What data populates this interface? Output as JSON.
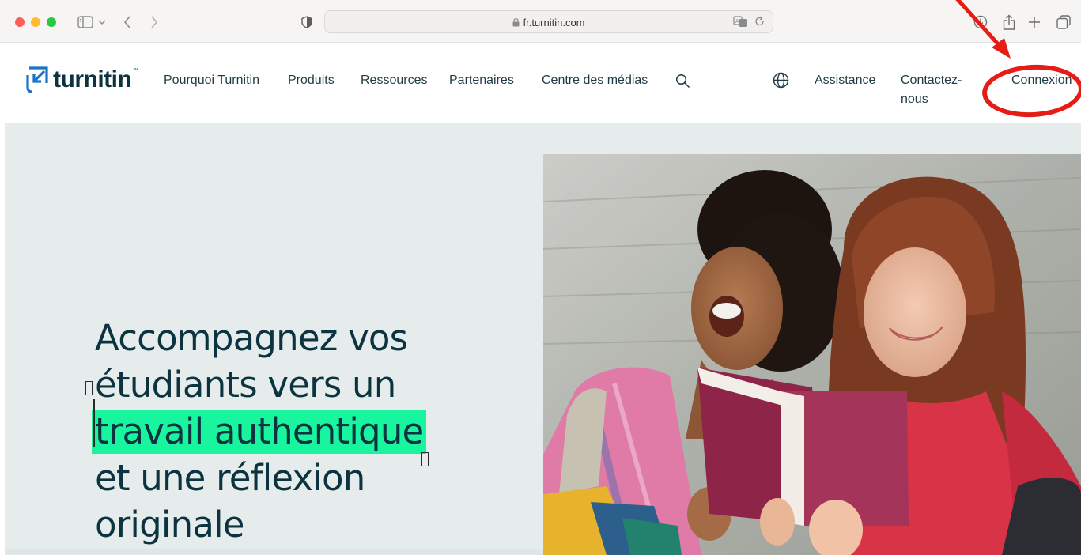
{
  "browser": {
    "url": "fr.turnitin.com"
  },
  "site": {
    "brand": "turnitin",
    "brand_tm": "™",
    "nav": [
      {
        "label": "Pourquoi Turnitin"
      },
      {
        "label": "Produits"
      },
      {
        "label": "Ressources"
      },
      {
        "label": "Partenaires"
      },
      {
        "label": "Centre des médias"
      }
    ],
    "right_nav": {
      "assistance": "Assistance",
      "contact_line1": "Contactez-",
      "contact_line2": "nous",
      "login": "Connexion"
    }
  },
  "hero": {
    "line1": "Accompagnez vos",
    "line2": "étudiants vers un",
    "line3_highlight": "travail authentique",
    "line4": "et une réflexion",
    "line5": "originale"
  },
  "colors": {
    "brand_dark": "#0c3440",
    "highlight": "#19f59e",
    "hero_bg": "#e6eceb",
    "annotation_red": "#e61d16"
  }
}
